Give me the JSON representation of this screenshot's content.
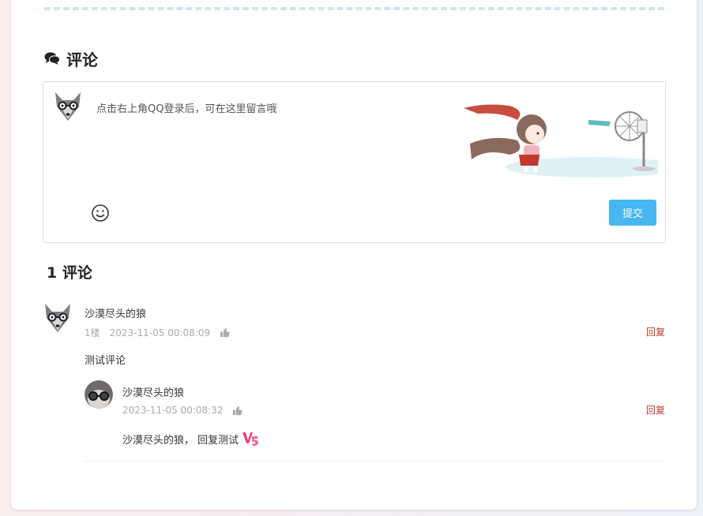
{
  "comments_section": {
    "title": "评论",
    "title_icon": "comments-icon"
  },
  "comment_box": {
    "placeholder": "点击右上角QQ登录后，可在这里留言哦",
    "emoji_icon": "smile-icon",
    "submit_label": "提交",
    "submit_color": "#47b6f1"
  },
  "count_title": "1 评论",
  "comments": [
    {
      "author": "沙漠尽头的狼",
      "floor": "1楼",
      "time": "2023-11-05 00:08:09",
      "reply_label": "回复",
      "body": "测试评论",
      "replies": [
        {
          "author": "沙漠尽头的狼",
          "time": "2023-11-05 00:08:32",
          "reply_label": "回复",
          "body": "沙漠尽头的狼， 回复测试",
          "sticker": "v5-sticker-icon"
        }
      ]
    }
  ],
  "colors": {
    "accent": "#47b6f1",
    "reply_link": "#c0392b",
    "dashed_line": "#cfe6f0"
  }
}
